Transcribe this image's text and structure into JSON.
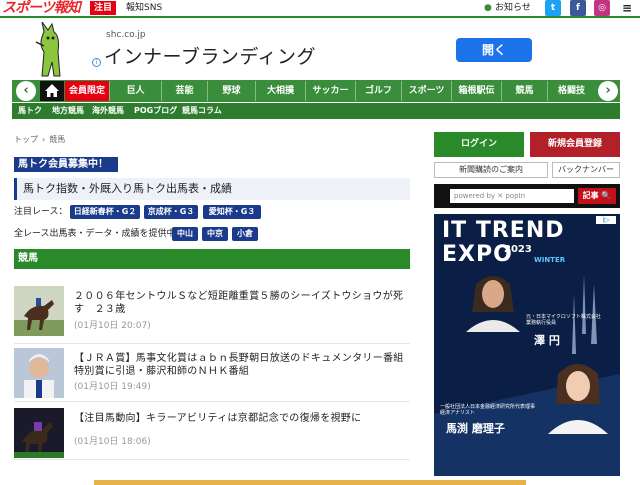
{
  "header": {
    "logo": "スポーツ報知",
    "attention": "注目",
    "sns": "報知SNS",
    "notice": "お知らせ",
    "social": {
      "twitter": "t",
      "facebook": "f",
      "instagram": "◎",
      "menu": "≡"
    }
  },
  "ad_top": {
    "domain": "shc.co.jp",
    "headline": "インナーブランディング",
    "cta": "開く",
    "info_icon": "i"
  },
  "nav": {
    "items": [
      "会員限定",
      "巨人",
      "芸能",
      "野球",
      "大相撲",
      "サッカー",
      "ゴルフ",
      "スポーツ",
      "箱根駅伝",
      "競馬",
      "格闘技"
    ],
    "prev": "‹",
    "next": "›"
  },
  "subnav": {
    "items": [
      "馬トク",
      "地方競馬",
      "海外競馬",
      "POGブログ",
      "競馬コラム"
    ]
  },
  "breadcrumb": {
    "home": "トップ",
    "current": "競馬",
    "sep": "›"
  },
  "promo": {
    "button": "馬トク会員募集中！",
    "feature": "馬トク指数・外厩入り馬トク出馬表・成績",
    "races_label": "注目レース：",
    "races": [
      "日経新春杯・G２",
      "京成杯・G３",
      "愛知杯・G３"
    ],
    "all_label": "全レース出馬表・データ・成績を提供中",
    "venues": [
      "中山",
      "中京",
      "小倉"
    ]
  },
  "section_title": "競馬",
  "news": [
    {
      "title": "２００６年セントウルＳなど短距離重賞５勝のシーイズトウショウが死す　２３歳",
      "time": "(01月10日 20:07)"
    },
    {
      "title": "【ＪＲＡ賞】馬事文化賞はａｂｎ長野朝日放送のドキュメンタリー番組　特別賞に引退・藤沢和師のＮＨＫ番組",
      "time": "(01月10日 19:49)"
    },
    {
      "title": "【注目馬動向】キラーアビリティは京都記念での復帰を視野に",
      "time": "(01月10日 18:06)"
    }
  ],
  "sidebar": {
    "login": "ログイン",
    "register": "新規会員登録",
    "subscribe": "新聞購読のご案内",
    "backnumber": "バックナンバー",
    "search_placeholder": "powered by ✕ popIn",
    "search_button": "記事 🔍"
  },
  "side_ad": {
    "line1": "IT TREND",
    "line2": "EXPO",
    "year": "2023",
    "season": "WINTER",
    "info": "i▷",
    "speaker1_caption": "元・日本マイクロソフト株式会社\n業務執行役員",
    "speaker1_name": "澤 円",
    "speaker2_caption": "一般社団法人日本金融経済研究所代表理事\n経済アナリスト",
    "speaker2_name": "馬渕 磨理子"
  },
  "colors": {
    "brand_green": "#2a8a2a",
    "accent_red": "#e60012",
    "promo_blue": "#1a3a8c"
  }
}
